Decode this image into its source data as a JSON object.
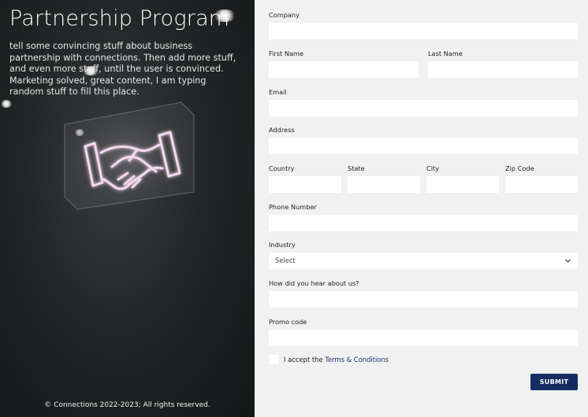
{
  "hero": {
    "title": "Partnership Program",
    "body": "tell some convincing stuff about business partnership with connections. Then add more stuff, and even more stuff, until the user is convinced. Marketing solved, great content, I am typing random stuff to fill this place.",
    "copyright": "© Connections 2022-2023; All rights reserved."
  },
  "form": {
    "company": {
      "label": "Company",
      "value": ""
    },
    "first_name": {
      "label": "First Name",
      "value": ""
    },
    "last_name": {
      "label": "Last Name",
      "value": ""
    },
    "email": {
      "label": "Email",
      "value": ""
    },
    "address": {
      "label": "Address",
      "value": ""
    },
    "country": {
      "label": "Country",
      "value": ""
    },
    "state": {
      "label": "State",
      "value": ""
    },
    "city": {
      "label": "City",
      "value": ""
    },
    "zip": {
      "label": "Zip Code",
      "value": ""
    },
    "phone": {
      "label": "Phone Number",
      "value": ""
    },
    "industry": {
      "label": "Industry",
      "selected": "Select"
    },
    "referral": {
      "label": "How did you hear about us?",
      "value": ""
    },
    "promo": {
      "label": "Promo code",
      "value": ""
    },
    "terms": {
      "prefix": "I accept the ",
      "link": "Terms & Conditions",
      "checked": false
    },
    "submit_label": "SUBMIT"
  },
  "colors": {
    "background": "#f1f1f1",
    "input_bg": "#ffffff",
    "primary": "#142c62",
    "link": "#1b2f6e",
    "neon": "#f3d9f0"
  },
  "icons": {
    "select_chevron": "chevron-down-icon",
    "hero_image": "handshake-neon-icon"
  }
}
